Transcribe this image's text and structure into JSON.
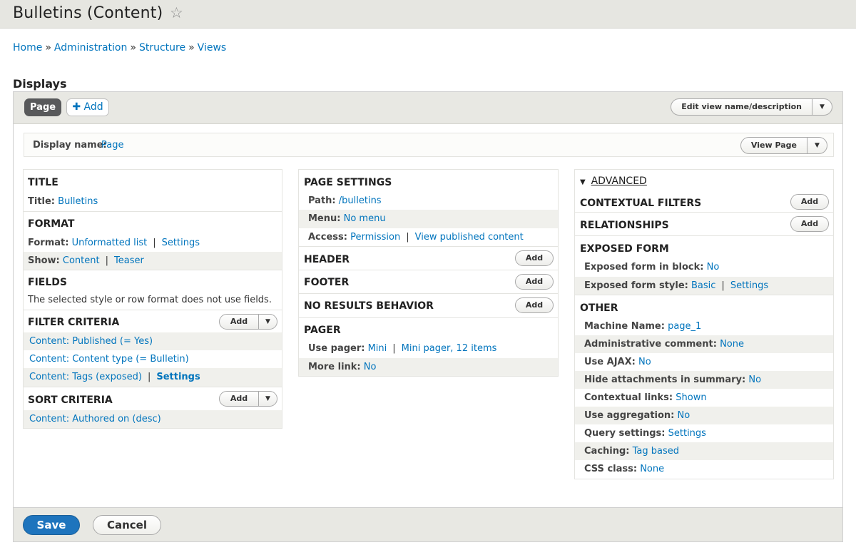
{
  "header": {
    "title": "Bulletins (Content)"
  },
  "breadcrumb": {
    "items": [
      "Home",
      "Administration",
      "Structure",
      "Views"
    ],
    "separator": "»"
  },
  "section_title": "Displays",
  "tabs": {
    "page_label": "Page",
    "add_label": "Add"
  },
  "edit_view_button": "Edit view name/description",
  "display_name": {
    "label": "Display name:",
    "value": "Page"
  },
  "view_page_button": "View Page",
  "col1": {
    "title_head": "TITLE",
    "title_label": "Title:",
    "title_value": "Bulletins",
    "format_head": "FORMAT",
    "format_label": "Format:",
    "format_value": "Unformatted list",
    "format_settings": "Settings",
    "show_label": "Show:",
    "show_value": "Content",
    "show_teaser": "Teaser",
    "fields_head": "FIELDS",
    "fields_note": "The selected style or row format does not use fields.",
    "filter_head": "FILTER CRITERIA",
    "filter_add": "Add",
    "filters": [
      "Content: Published (= Yes)",
      "Content: Content type (= Bulletin)",
      "Content: Tags (exposed)"
    ],
    "filter_settings": "Settings",
    "sort_head": "SORT CRITERIA",
    "sort_add": "Add",
    "sort_item": "Content: Authored on (desc)"
  },
  "col2": {
    "page_settings_head": "PAGE SETTINGS",
    "path_label": "Path:",
    "path_value": "/bulletins",
    "menu_label": "Menu:",
    "menu_value": "No menu",
    "access_label": "Access:",
    "access_value": "Permission",
    "access_detail": "View published content",
    "header_head": "HEADER",
    "footer_head": "FOOTER",
    "no_results_head": "NO RESULTS BEHAVIOR",
    "add_label": "Add",
    "pager_head": "PAGER",
    "use_pager_label": "Use pager:",
    "use_pager_value": "Mini",
    "use_pager_detail": "Mini pager, 12 items",
    "more_link_label": "More link:",
    "more_link_value": "No"
  },
  "col3": {
    "advanced_head": "ADVANCED",
    "contextual_head": "CONTEXTUAL FILTERS",
    "relationships_head": "RELATIONSHIPS",
    "add_label": "Add",
    "exposed_head": "EXPOSED FORM",
    "exposed_block_label": "Exposed form in block:",
    "exposed_block_value": "No",
    "exposed_style_label": "Exposed form style:",
    "exposed_style_value": "Basic",
    "exposed_style_settings": "Settings",
    "other_head": "OTHER",
    "other_items": [
      {
        "label": "Machine Name:",
        "value": "page_1"
      },
      {
        "label": "Administrative comment:",
        "value": "None"
      },
      {
        "label": "Use AJAX:",
        "value": "No"
      },
      {
        "label": "Hide attachments in summary:",
        "value": "No"
      },
      {
        "label": "Contextual links:",
        "value": "Shown"
      },
      {
        "label": "Use aggregation:",
        "value": "No"
      },
      {
        "label": "Query settings:",
        "value": "Settings"
      },
      {
        "label": "Caching:",
        "value": "Tag based"
      },
      {
        "label": "CSS class:",
        "value": "None"
      }
    ]
  },
  "actions": {
    "save": "Save",
    "cancel": "Cancel"
  },
  "colors": {
    "link": "#0074bd",
    "save_bg": "#1e74bd",
    "header_bg": "#e6e6e1",
    "tab_bg": "#58595b"
  }
}
